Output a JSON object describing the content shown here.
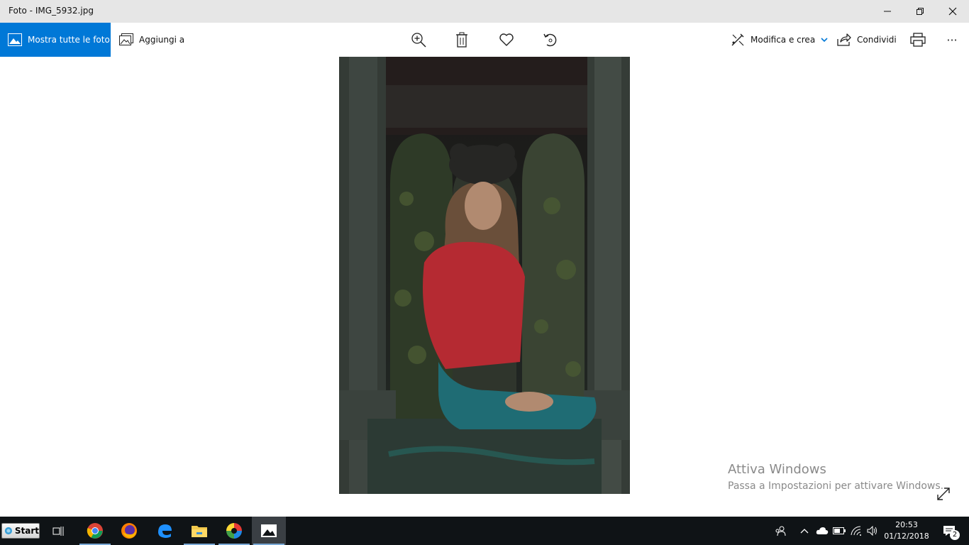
{
  "window": {
    "title": "Foto - IMG_5932.jpg",
    "icons": [
      "minimize-icon",
      "restore-icon",
      "close-icon"
    ]
  },
  "toolbar": {
    "show_all_label": "Mostra tutte le foto",
    "add_to_label": "Aggiungi a",
    "edit_create_label": "Modifica e crea",
    "share_label": "Condividi",
    "more_label": "···",
    "icons": [
      "zoom-in-icon",
      "delete-icon",
      "favorite-heart-icon",
      "rotate-icon",
      "print-icon"
    ]
  },
  "watermark": {
    "title": "Attiva Windows",
    "subtitle": "Passa a Impostazioni per attivare Windows."
  },
  "taskbar": {
    "start_label": "Start",
    "apps": [
      "task-view-icon",
      "chrome-icon",
      "firefox-icon",
      "edge-icon",
      "file-explorer-icon",
      "color-app-icon",
      "photos-app-icon"
    ],
    "clock_time": "20:53",
    "clock_date": "01/12/2018",
    "notification_count": "2"
  },
  "colors": {
    "accent": "#0078d7",
    "titlebar": "#e6e6e6",
    "taskbar": "#0f1316"
  }
}
